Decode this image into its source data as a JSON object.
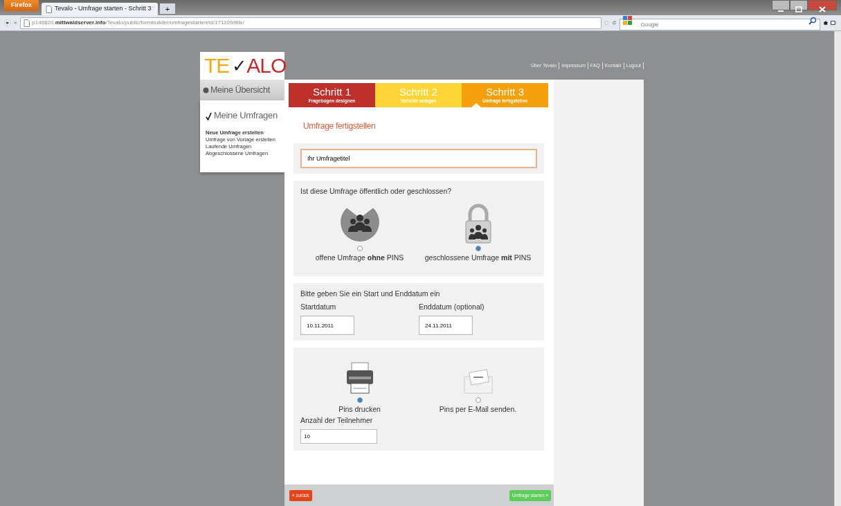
{
  "browser": {
    "menu_button": "Firefox",
    "tabs": [
      {
        "title": "Tevalo - Umfrage starten - Schritt 3",
        "selected": true
      }
    ],
    "new_tab": "+",
    "url_host": "p146620.",
    "url_domain": "mittwaldserver.info",
    "url_path": "/Tevalo/public/formbuilder/umfragestarten/id/171109/title/",
    "search": {
      "placeholder": "Google"
    }
  },
  "logo": {
    "part1": "TE",
    "check": "✓",
    "part2": "ALO"
  },
  "top_links": [
    "Über Tevalo",
    "Impressum",
    "FAQ",
    "Kontakt",
    "Logout"
  ],
  "sidebar": {
    "overview": "Meine Übersicht",
    "section": "Meine Umfragen",
    "items": [
      {
        "label": "Neue Umfrage erstellen",
        "selected": true
      },
      {
        "label": "Umfrage von Vorlage erstellen",
        "selected": false
      },
      {
        "label": "Laufende Umfragen",
        "selected": false
      },
      {
        "label": "Abgeschlossene Umfragen",
        "selected": false
      }
    ]
  },
  "steps": [
    {
      "title": "Schritt 1",
      "subtitle": "Fragebogen designen",
      "color": "#c0302a",
      "selected": false
    },
    {
      "title": "Schritt 2",
      "subtitle": "Verteiler anlegen",
      "color": "#fcd535",
      "selected": false
    },
    {
      "title": "Schritt 3",
      "subtitle": "Umfrage fertigstellen",
      "color": "#f5a00a",
      "selected": true
    }
  ],
  "heading": "Umfrage fertigstellen",
  "title_field": {
    "value": "Ihr Umfragetitel"
  },
  "visibility": {
    "question": "Ist diese Umfrage öffentlich oder geschlossen?",
    "options": [
      {
        "kind": "open",
        "label": "offene Umfrage **ohne** PINS",
        "selected": false
      },
      {
        "kind": "closed",
        "label": "geschlossene Umfrage **mit** PINS",
        "selected": true
      }
    ]
  },
  "dates": {
    "intro": "Bitte geben Sie ein Start und Enddatum ein",
    "fields": [
      {
        "label": "Startdatum",
        "value": "10.11.2011"
      },
      {
        "label": "Enddatum (optional)",
        "value": "24.11.2011"
      }
    ]
  },
  "pins": {
    "options": [
      {
        "kind": "print",
        "label": "Pins drucken",
        "selected": true
      },
      {
        "kind": "email",
        "label": "Pins per E-Mail senden.",
        "selected": false
      }
    ],
    "count_label": "Anzahl der Teilnehmer",
    "count_value": "10"
  },
  "footer": {
    "back": "« zurück",
    "next": "Umfrage starten »"
  }
}
